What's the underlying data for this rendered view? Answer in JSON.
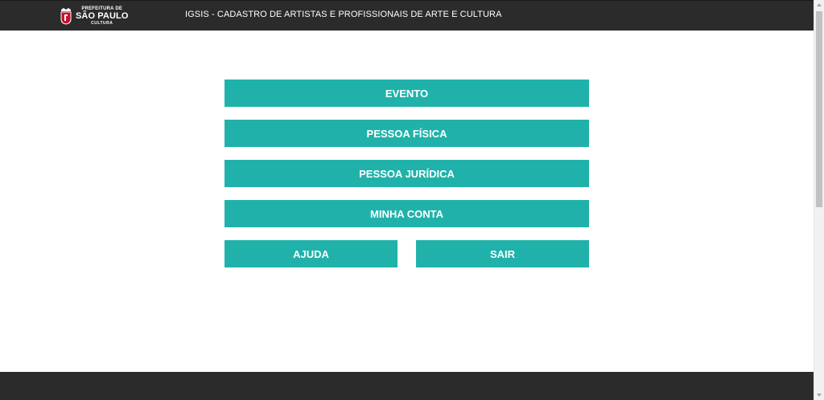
{
  "header": {
    "logo": {
      "line1": "PREFEITURA DE",
      "line2": "SÃO PAULO",
      "line3": "CULTURA"
    },
    "title": "IGSIS - CADASTRO DE ARTISTAS E PROFISSIONAIS DE ARTE E CULTURA"
  },
  "menu": {
    "evento": "EVENTO",
    "pessoa_fisica": "PESSOA FÍSICA",
    "pessoa_juridica": "PESSOA JURÍDICA",
    "minha_conta": "MINHA CONTA",
    "ajuda": "AJUDA",
    "sair": "SAIR"
  },
  "colors": {
    "header_bg": "#2b2b2b",
    "button_bg": "#20b2aa",
    "button_text": "#ffffff",
    "footer_bg": "#2b2b2b"
  },
  "icons": {
    "logo_crest": "sao-paulo-crest-icon",
    "scroll_up": "scroll-up-arrow-icon",
    "scroll_down": "scroll-down-arrow-icon"
  },
  "scrollbar": {
    "thumb_fraction": 0.52
  }
}
